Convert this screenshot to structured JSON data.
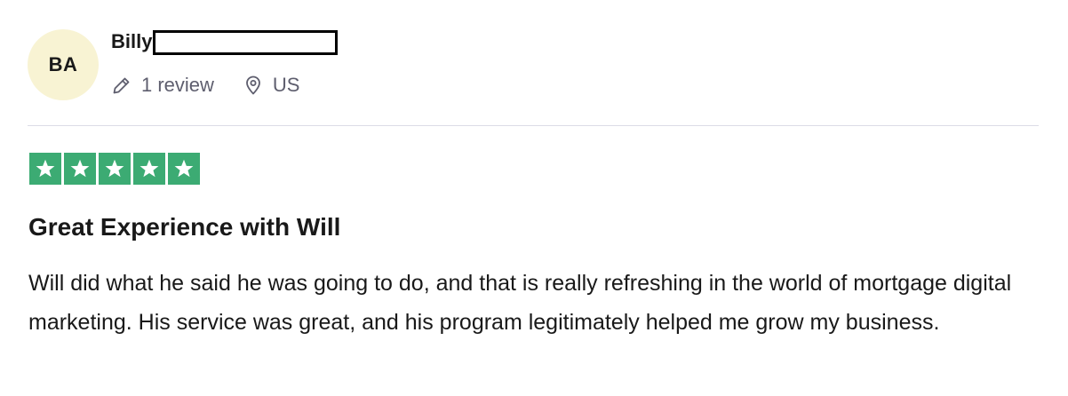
{
  "reviewer": {
    "initials": "BA",
    "name": "Billy",
    "review_count": "1 review",
    "location": "US"
  },
  "rating": {
    "stars": 5,
    "max_stars": 5,
    "color": "#3cab73"
  },
  "review": {
    "title": "Great Experience with Will",
    "body": "Will did what he said he was going to do, and that is really refreshing in the world of mortgage digital marketing. His service was great, and his program legitimately helped me grow my business."
  },
  "icons": {
    "review_count": "pencil-icon",
    "location": "location-pin-icon",
    "star": "star-icon"
  }
}
